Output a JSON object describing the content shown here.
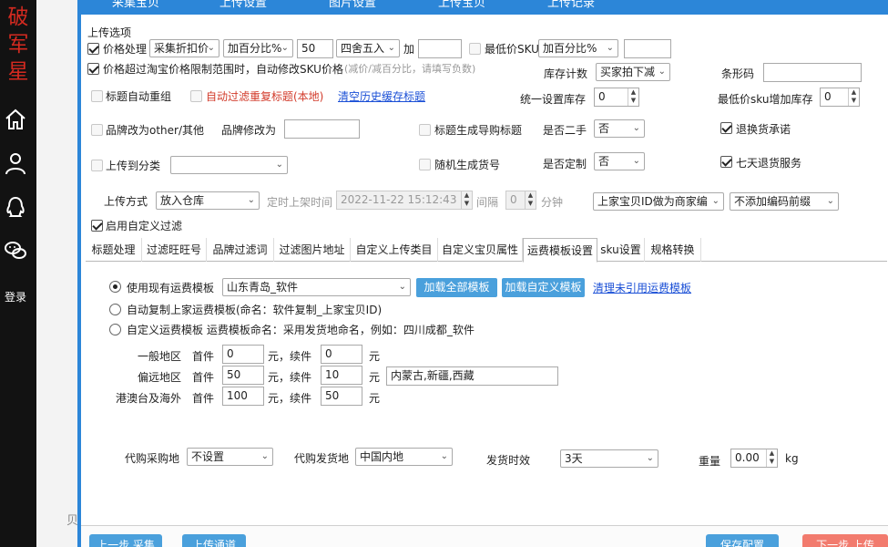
{
  "sidebar": {
    "brand": [
      "破",
      "军",
      "星"
    ],
    "login_label": "登录"
  },
  "background": {
    "glyph": "贝"
  },
  "topnav": {
    "items": [
      "采集宝贝",
      "上传设置",
      "图片设置",
      "上传宝贝",
      "上传记录"
    ]
  },
  "upload_options": {
    "section_title": "上传选项",
    "price_process_label": "价格处理",
    "price_source": "采集折扣价",
    "price_mode": "加百分比%",
    "price_value": "50",
    "rounding": "四舍五入",
    "add_label": "加",
    "add_value": "",
    "min_price_sku_label": "最低价SKU",
    "min_price_mode": "加百分比%",
    "min_price_value": "",
    "auto_modify_label": "价格超过淘宝价格限制范围时，自动修改SKU价格",
    "auto_modify_hint": "(减价/减百分比，请填写负数)",
    "stock_count_label": "库存计数",
    "stock_count_value": "买家拍下减",
    "barcode_label": "条形码",
    "barcode_value": "",
    "title_reorg_label": "标题自动重组",
    "filter_dup_title_label": "自动过滤重复标题(本地)",
    "clear_history_link": "清空历史缓存标题",
    "unified_stock_label": "统一设置库存",
    "unified_stock_value": "0",
    "min_sku_stock_label": "最低价sku增加库存",
    "min_sku_stock_value": "0",
    "brand_other_label": "品牌改为other/其他",
    "brand_modify_label": "品牌修改为",
    "brand_modify_value": "",
    "title_shopping_label": "标题生成导购标题",
    "second_hand_label": "是否二手",
    "second_hand_value": "否",
    "return_promise_label": "退换货承诺",
    "upload_category_label": "上传到分类",
    "upload_category_value": "",
    "random_code_label": "随机生成货号",
    "custom_made_label": "是否定制",
    "custom_made_value": "否",
    "seven_day_label": "七天退货服务",
    "upload_method_label": "上传方式",
    "upload_method_value": "放入仓库",
    "timed_label": "定时上架时间",
    "timed_value": "2022-11-22  15:12:43",
    "interval_label": "间隔",
    "interval_value": "0",
    "minute_label": "分钟",
    "merchant_code_value": "上家宝贝ID做为商家编",
    "prefix_value": "不添加编码前缀",
    "custom_filter_label": "启用自定义过滤"
  },
  "tabs": [
    "标题处理",
    "过滤旺旺号",
    "品牌过滤词",
    "过滤图片地址",
    "自定义上传类目",
    "自定义宝贝属性",
    "运费模板设置",
    "sku设置",
    "规格转换"
  ],
  "freight": {
    "use_existing_label": "使用现有运费模板",
    "template_value": "山东青岛_软件",
    "load_all_button": "加载全部模板",
    "load_custom_button": "加载自定义模板",
    "clean_unused_link": "清理未引用运费模板",
    "auto_copy_label": "自动复制上家运费模板(命名：软件复制_上家宝贝ID)",
    "custom_template_label": "自定义运费模板 运费模板命名：采用发货地命名，例如：四川成都_软件",
    "rows": [
      {
        "region": "一般地区",
        "first_label": "首件",
        "first_value": "0",
        "unit1": "元，续件",
        "next_value": "0",
        "unit2": "元",
        "extra": ""
      },
      {
        "region": "偏远地区",
        "first_label": "首件",
        "first_value": "50",
        "unit1": "元，续件",
        "next_value": "10",
        "unit2": "元",
        "extra": "内蒙古,新疆,西藏"
      },
      {
        "region": "港澳台及海外",
        "first_label": "首件",
        "first_value": "100",
        "unit1": "元，续件",
        "next_value": "50",
        "unit2": "元",
        "extra": ""
      }
    ],
    "proxy_purchase_label": "代购采购地",
    "proxy_purchase_value": "不设置",
    "proxy_ship_label": "代购发货地",
    "proxy_ship_value": "中国内地",
    "ship_time_label": "发货时效",
    "ship_time_value": "3天",
    "weight_label": "重量",
    "weight_value": "0.00",
    "weight_unit": "kg"
  },
  "bottom": {
    "prev_collect": "上一步 采集",
    "upload_channel": "上传通道",
    "save_config": "保存配置",
    "next_upload": "下一步 上传"
  }
}
